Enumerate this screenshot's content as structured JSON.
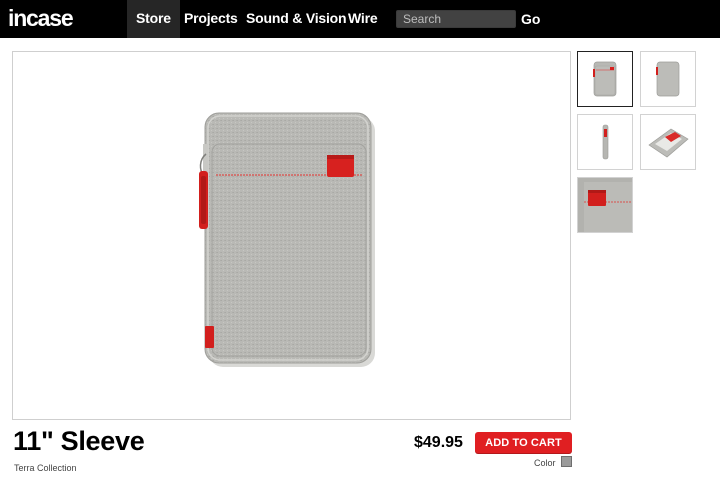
{
  "brand": {
    "logo_text": "incase"
  },
  "nav": {
    "items": [
      {
        "label": "Store",
        "active": true
      },
      {
        "label": "Projects",
        "active": false
      },
      {
        "label": "Sound & Vision",
        "active": false
      },
      {
        "label": "Wire",
        "active": false
      }
    ],
    "search_placeholder": "Search",
    "go_label": "Go"
  },
  "product": {
    "title": "11\" Sleeve",
    "collection": "Terra Collection",
    "price": "$49.95",
    "add_to_cart_label": "ADD TO CART",
    "color_label": "Color",
    "selected_color": "#9b9b9b"
  },
  "thumbnails": [
    {
      "name": "sleeve-front",
      "selected": true
    },
    {
      "name": "sleeve-back",
      "selected": false
    },
    {
      "name": "sleeve-side",
      "selected": false
    },
    {
      "name": "sleeve-open",
      "selected": false
    },
    {
      "name": "sleeve-detail",
      "selected": false
    }
  ],
  "colors": {
    "accent": "#e01f22",
    "fabric": "#b5b5b1",
    "nav_bg": "#000000"
  }
}
